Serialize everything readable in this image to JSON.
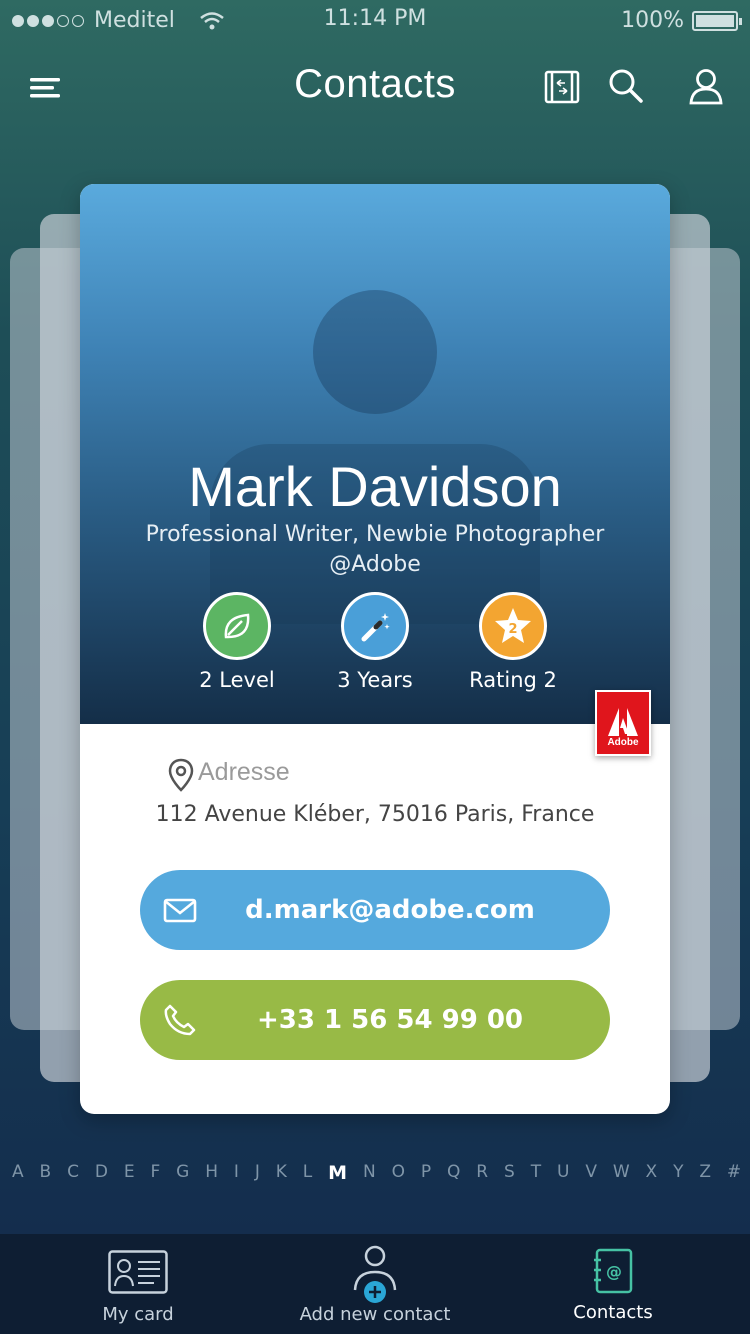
{
  "status": {
    "carrier": "Meditel",
    "time": "11:14 PM",
    "battery": "100%",
    "signal_bars": 3
  },
  "nav": {
    "title": "Contacts",
    "icons": [
      "menu-icon",
      "book-icon",
      "search-icon",
      "user-icon"
    ]
  },
  "contact": {
    "name": "Mark Davidson",
    "subtitle_line1": "Professional Writer, Newbie Photographer",
    "subtitle_line2": "@Adobe",
    "badges": [
      {
        "label": "2 Level",
        "color": "#5cb563",
        "icon": "leaf-icon"
      },
      {
        "label": "3 Years",
        "color": "#4a9fd8",
        "icon": "wand-icon"
      },
      {
        "label": "Rating 2",
        "color": "#f3a531",
        "icon": "star-icon",
        "star_number": "2"
      }
    ],
    "company_logo": "Adobe",
    "address_label": "Adresse",
    "address": "112 Avenue Kléber, 75016 Paris, France",
    "email": "d.mark@adobe.com",
    "phone": "+33 1 56 54 99 00"
  },
  "alphabet": [
    "A",
    "B",
    "C",
    "D",
    "E",
    "F",
    "G",
    "H",
    "I",
    "J",
    "K",
    "L",
    "M",
    "N",
    "O",
    "P",
    "Q",
    "R",
    "S",
    "T",
    "U",
    "V",
    "W",
    "X",
    "Y",
    "Z",
    "#"
  ],
  "alphabet_active": "M",
  "tabbar": {
    "my_card": "My card",
    "add_contact": "Add  new contact",
    "contacts": "Contacts"
  },
  "colors": {
    "email": "#55a9dd",
    "phone": "#98ba46",
    "adobe_red": "#e0151c"
  }
}
